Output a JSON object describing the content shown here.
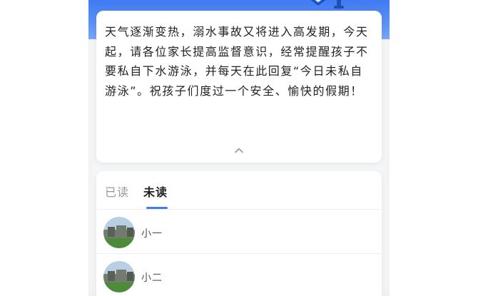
{
  "notice": {
    "message": "天气逐渐变热，溺水事故又将进入高发期，今天起，请各位家长提高监督意识，经常提醒孩子不要私自下水游泳，并每天在此回复“今日未私自游泳”。祝孩子们度过一个安全、愉快的假期！",
    "collapse_icon": "chevron-up-icon"
  },
  "tabs": [
    {
      "label": "已读",
      "active": false
    },
    {
      "label": "未读",
      "active": true
    }
  ],
  "readers": [
    {
      "name": "小一"
    },
    {
      "name": "小二"
    }
  ],
  "colors": {
    "accent": "#3f7bf2",
    "banner": "#4f86f4",
    "page_background": "#f5f6f8"
  }
}
